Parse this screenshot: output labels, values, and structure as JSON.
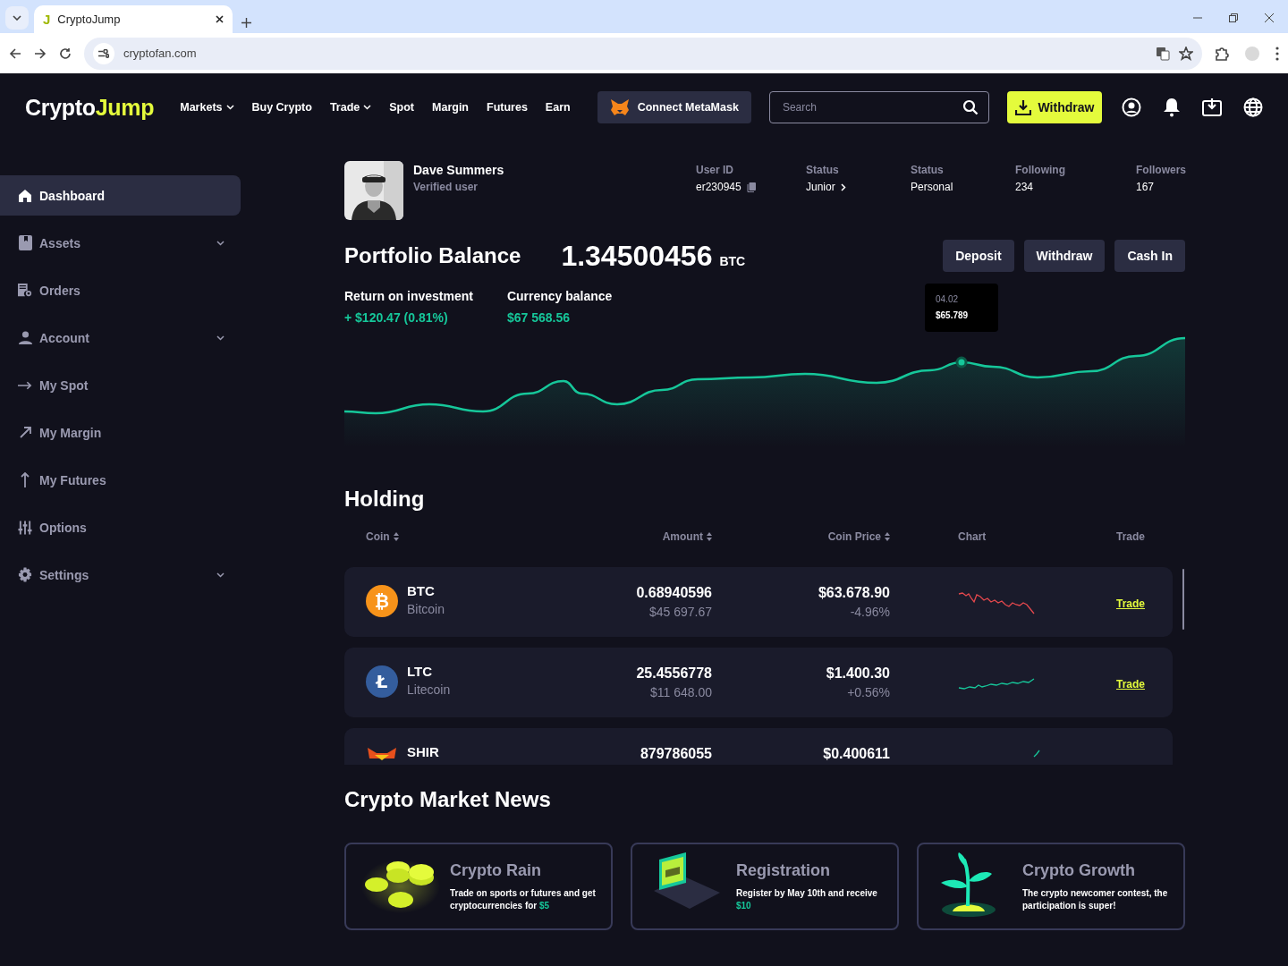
{
  "browser": {
    "tab_title": "CryptoJump",
    "favicon_letter": "J",
    "url": "cryptofan.com"
  },
  "header": {
    "logo": {
      "first": "Crypto",
      "second": "Jump"
    },
    "nav": [
      {
        "label": "Markets",
        "dropdown": true
      },
      {
        "label": "Buy Crypto",
        "dropdown": false
      },
      {
        "label": "Trade",
        "dropdown": true
      },
      {
        "label": "Spot",
        "dropdown": false
      },
      {
        "label": "Margin",
        "dropdown": false
      },
      {
        "label": "Futures",
        "dropdown": false
      },
      {
        "label": "Earn",
        "dropdown": false
      }
    ],
    "connect_button": "Connect MetaMask",
    "search": {
      "placeholder": "Search"
    },
    "withdraw_button": "Withdraw"
  },
  "sidebar": {
    "items": [
      {
        "label": "Dashboard",
        "selected": true,
        "expandable": false
      },
      {
        "label": "Assets",
        "selected": false,
        "expandable": true
      },
      {
        "label": "Orders",
        "selected": false,
        "expandable": false
      },
      {
        "label": "Account",
        "selected": false,
        "expandable": true
      },
      {
        "label": "My Spot",
        "selected": false,
        "expandable": false
      },
      {
        "label": "My Margin",
        "selected": false,
        "expandable": false
      },
      {
        "label": "My Futures",
        "selected": false,
        "expandable": false
      },
      {
        "label": "Options",
        "selected": false,
        "expandable": false
      },
      {
        "label": "Settings",
        "selected": false,
        "expandable": true
      }
    ]
  },
  "profile": {
    "name": "Dave Summers",
    "subtitle": "Verified user",
    "stats": [
      {
        "label": "User ID",
        "value": "er230945",
        "kind": "copy"
      },
      {
        "label": "Status",
        "value": "Junior",
        "kind": "link"
      },
      {
        "label": "Status",
        "value": "Personal",
        "kind": "plain"
      },
      {
        "label": "Following",
        "value": "234",
        "kind": "plain"
      },
      {
        "label": "Followers",
        "value": "167",
        "kind": "plain"
      }
    ]
  },
  "portfolio": {
    "title": "Portfolio Balance",
    "amount": "1.34500456",
    "unit": "BTC",
    "buttons": [
      "Deposit",
      "Withdraw",
      "Cash In"
    ],
    "metrics": [
      {
        "label": "Return on investment",
        "value": "+ $120.47 (0.81%)"
      },
      {
        "label": "Currency balance",
        "value": "$67 568.56"
      }
    ],
    "tooltip": {
      "date": "04.02",
      "value": "$65.789"
    }
  },
  "holding": {
    "title": "Holding",
    "columns": [
      {
        "label": "Coin",
        "sortable": true
      },
      {
        "label": "Amount",
        "sortable": true
      },
      {
        "label": "Coin Price",
        "sortable": true
      },
      {
        "label": "Chart",
        "sortable": false
      },
      {
        "label": "Trade",
        "sortable": false
      }
    ],
    "rows": [
      {
        "symbol": "BTC",
        "name": "Bitcoin",
        "glyph": "₿",
        "color": "#f7931a",
        "amount": "0.68940596",
        "value": "$45 697.67",
        "price": "$63.678.90",
        "change": "-4.96%",
        "sparkline": {
          "color": "#e5484d"
        },
        "action": "Trade"
      },
      {
        "symbol": "LTC",
        "name": "Litecoin",
        "glyph": "Ł",
        "color": "#345d9d",
        "amount": "25.4556778",
        "value": "$11 648.00",
        "price": "$1.400.30",
        "change": "+0.56%",
        "sparkline": {
          "color": "#16c79a"
        },
        "action": "Trade"
      },
      {
        "symbol": "SHIR",
        "color": "#e8501c",
        "amount": "879786055",
        "price": "$0.400611",
        "sparkline": {
          "color": "#16c79a"
        }
      }
    ]
  },
  "news": {
    "title": "Crypto Market News",
    "cards": [
      {
        "title": "Crypto Rain",
        "text": "Trade on sports or futures and get cryptocurrencies for ",
        "highlight": "$5"
      },
      {
        "title": "Registration",
        "text": "Register by May 10th and receive ",
        "highlight": "$10"
      },
      {
        "title": "Crypto Growth",
        "text": "The crypto newcomer contest, the participation is super!"
      }
    ]
  }
}
